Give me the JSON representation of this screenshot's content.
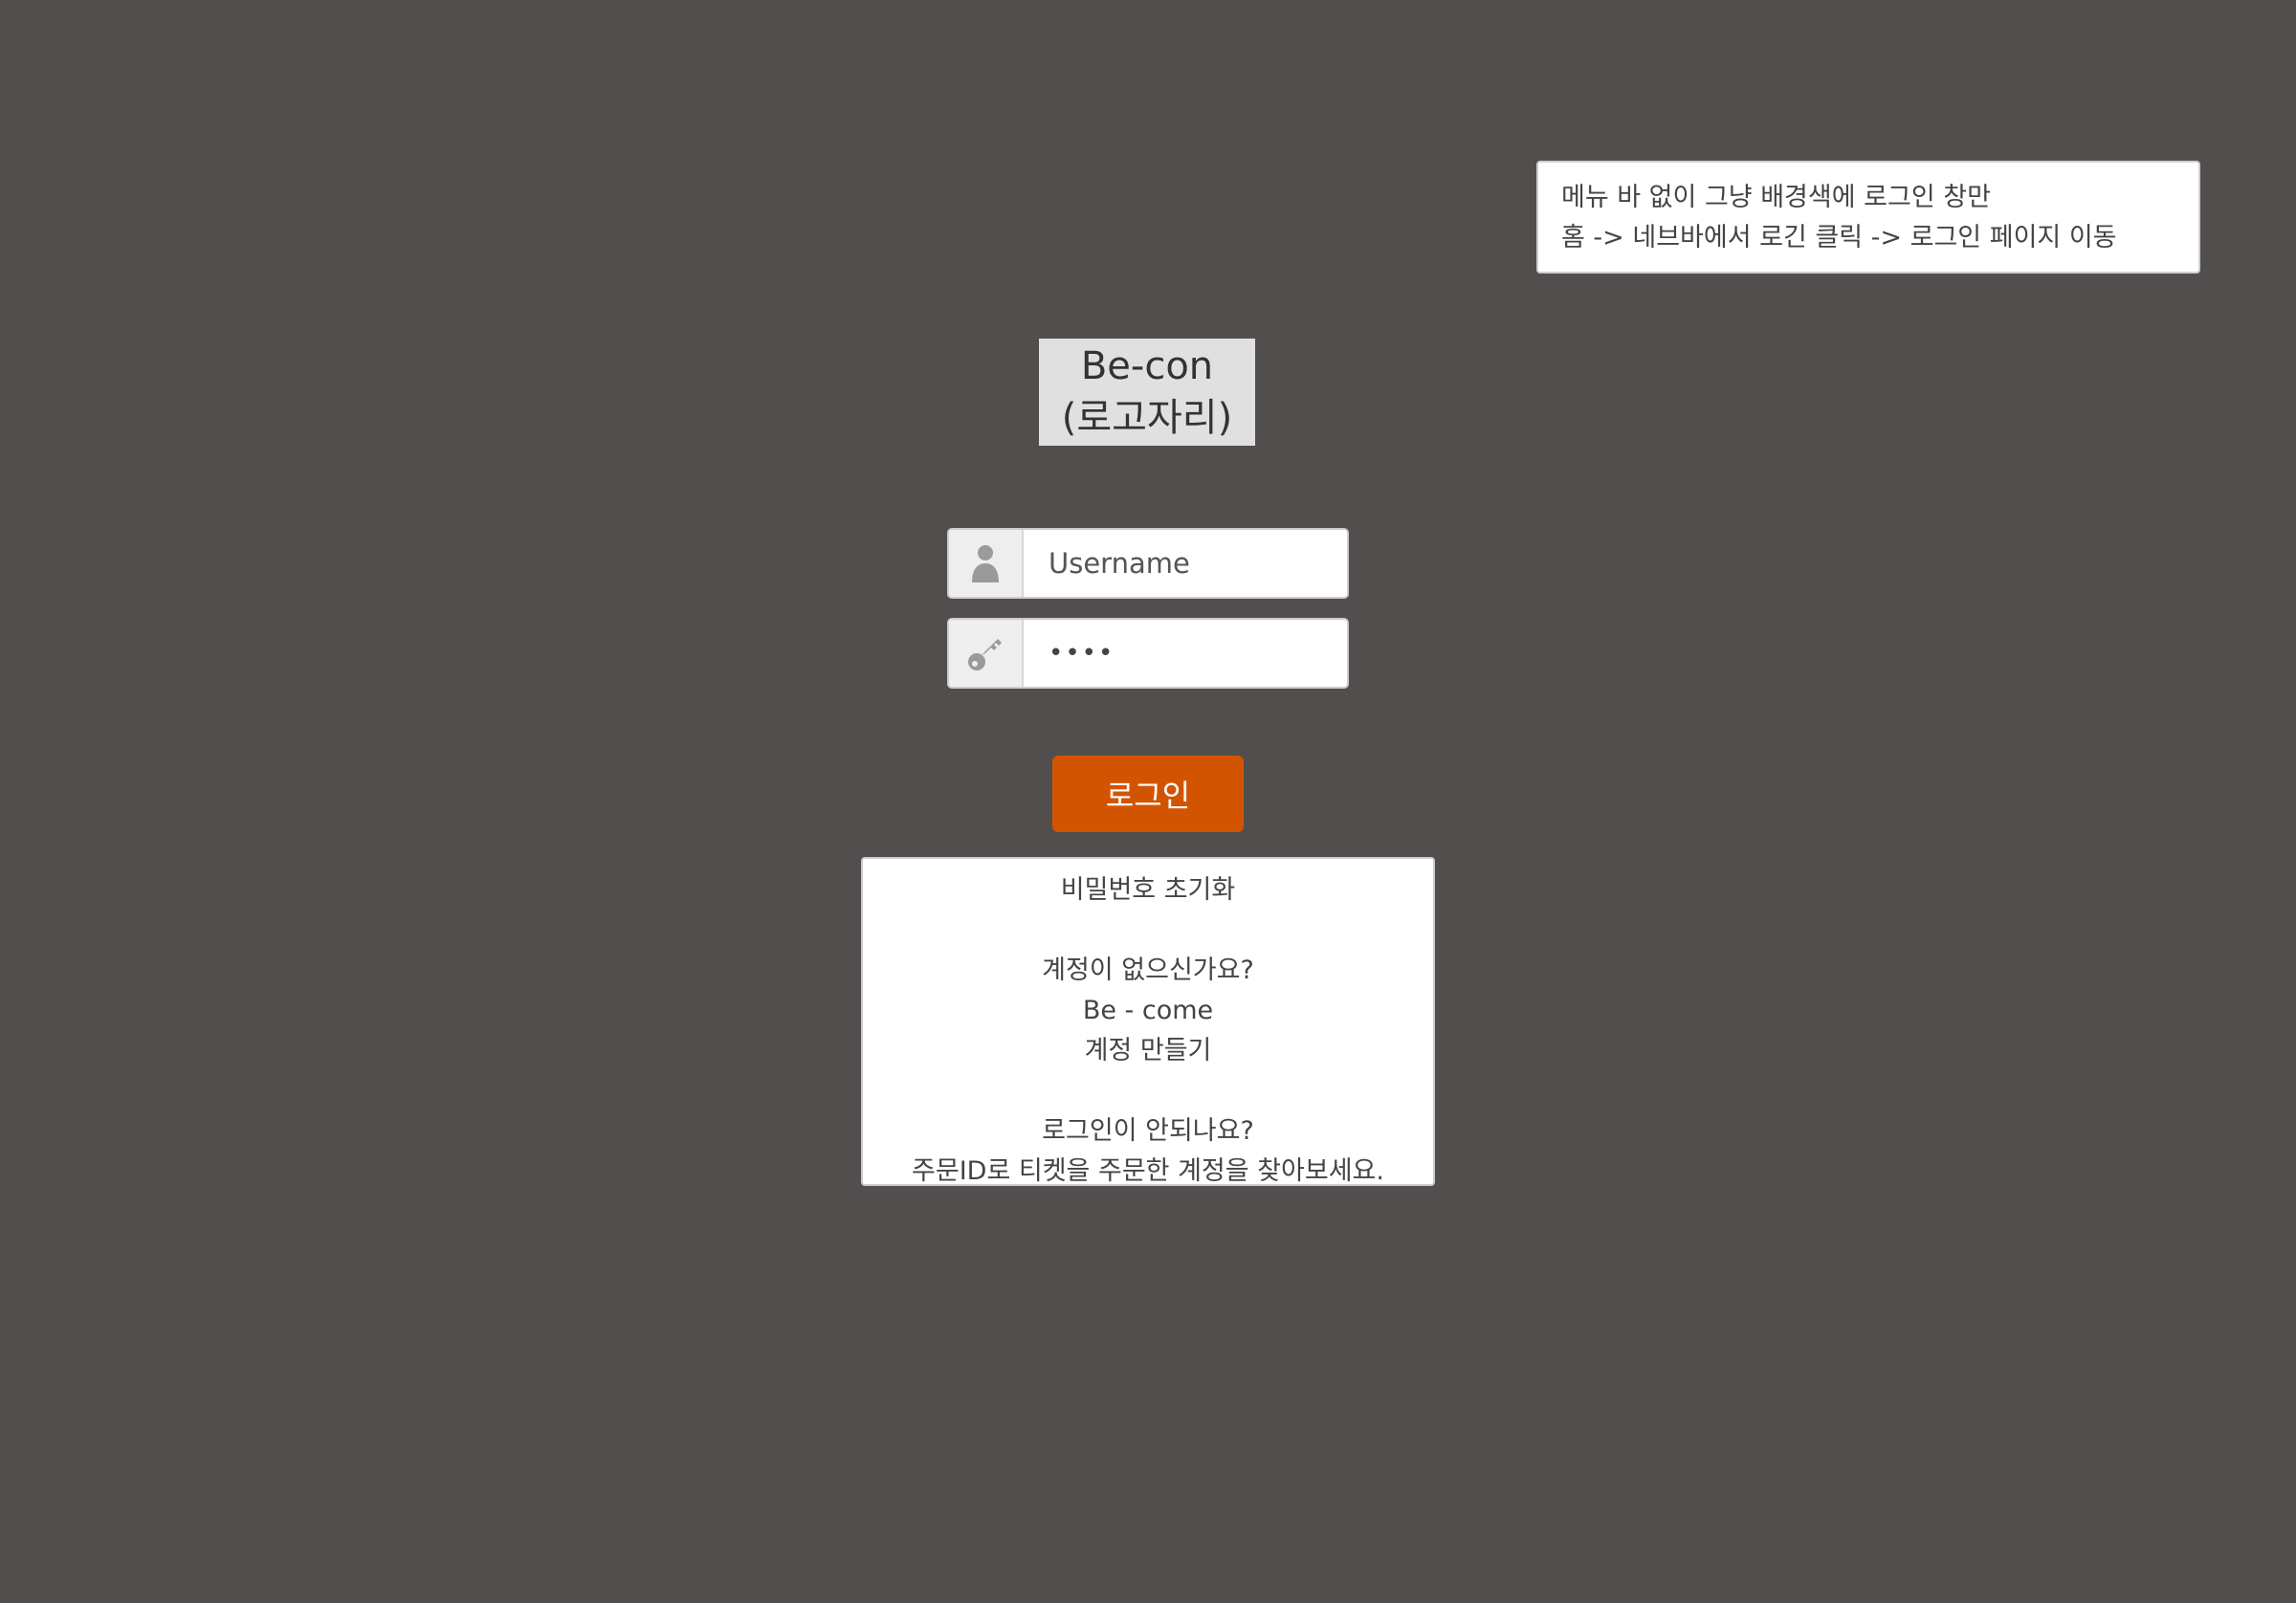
{
  "note": {
    "line1": "메뉴 바 없이 그냥 배경색에 로그인 창만",
    "line2": "홈 -> 네브바에서 로긴 클릭 -> 로그인 페이지 이동"
  },
  "logo": {
    "line1": "Be-con",
    "line2": "(로고자리)"
  },
  "form": {
    "username_placeholder": "Username",
    "password_value": "••••",
    "login_label": "로그인"
  },
  "help": {
    "reset_password": "비밀번호 초기화",
    "no_account": "계정이 없으신가요?",
    "brand": "Be - come",
    "create_account": "계정 만들기",
    "cant_login": "로그인이 안되나요?",
    "find_account": "주문ID로 티켓을 주문한 계정을 찾아보세요."
  },
  "colors": {
    "background": "#524e4d",
    "accent": "#d35400"
  },
  "icons": {
    "user": "user-icon",
    "key": "key-icon"
  }
}
